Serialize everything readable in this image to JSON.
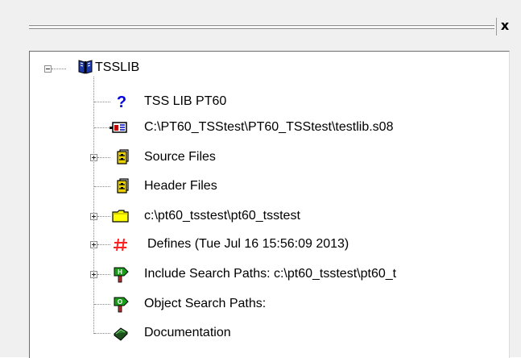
{
  "pane": {
    "close_glyph": "x"
  },
  "tree": {
    "root": {
      "label": "TSSLIB",
      "icon": "book-icon",
      "expanded": true
    },
    "children": [
      {
        "label": "TSS LIB PT60",
        "icon": "question-mark-icon",
        "expander": "none"
      },
      {
        "label": "C:\\PT60_TSStest\\PT60_TSStest\\testlib.s08",
        "icon": "project-file-icon",
        "expander": "none"
      },
      {
        "label": "Source Files",
        "icon": "file-cabinet-icon",
        "expander": "plus"
      },
      {
        "label": "Header Files",
        "icon": "file-cabinet-icon",
        "expander": "none"
      },
      {
        "label": "c:\\pt60_tsstest\\pt60_tsstest",
        "icon": "folder-icon",
        "expander": "plus"
      },
      {
        "label": "Defines (Tue Jul 16 15:56:09 2013)",
        "icon": "hash-icon",
        "expander": "plus"
      },
      {
        "label": "Include Search Paths: c:\\pt60_tsstest\\pt60_t",
        "icon": "include-path-sign-icon",
        "expander": "plus"
      },
      {
        "label": "Object Search Paths:",
        "icon": "object-path-sign-icon",
        "expander": "none"
      },
      {
        "label": "Documentation",
        "icon": "documentation-book-icon",
        "expander": "none"
      }
    ]
  },
  "colors": {
    "pane_background": "#f0f0f0",
    "tree_background": "#ffffff",
    "defines_hash": "#ff2020",
    "sign_green": "#1a9e1a",
    "folder_yellow": "#ffff00"
  }
}
